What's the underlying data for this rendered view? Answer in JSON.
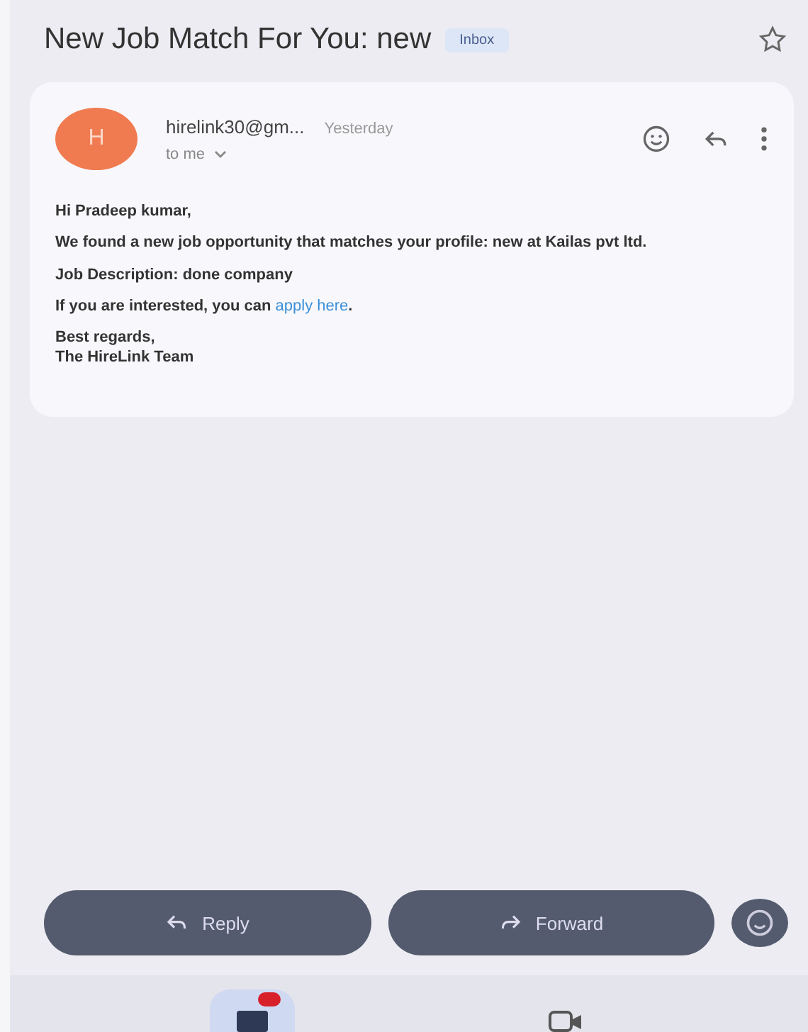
{
  "subject": "New Job Match For You: new",
  "label": "Inbox",
  "message": {
    "avatar_letter": "H",
    "sender": "hirelink30@gm...",
    "time": "Yesterday",
    "recipient": "to me",
    "paragraphs": [
      {
        "text": "Hi Pradeep kumar,"
      },
      {
        "text": "We found a new job opportunity that matches your profile: new at Kailas pvt ltd."
      },
      {
        "text": "Job Description: done company"
      },
      {
        "text": "If you are interested, you can ",
        "link": "apply here",
        "after": "."
      },
      {
        "text": "Best regards,\nThe HireLink Team"
      }
    ]
  },
  "actions": [
    "Reply",
    "Forward"
  ],
  "nav": [
    {
      "kind": "mail",
      "selected": true,
      "badge": true
    },
    {
      "kind": "video",
      "selected": false,
      "badge": false
    }
  ]
}
